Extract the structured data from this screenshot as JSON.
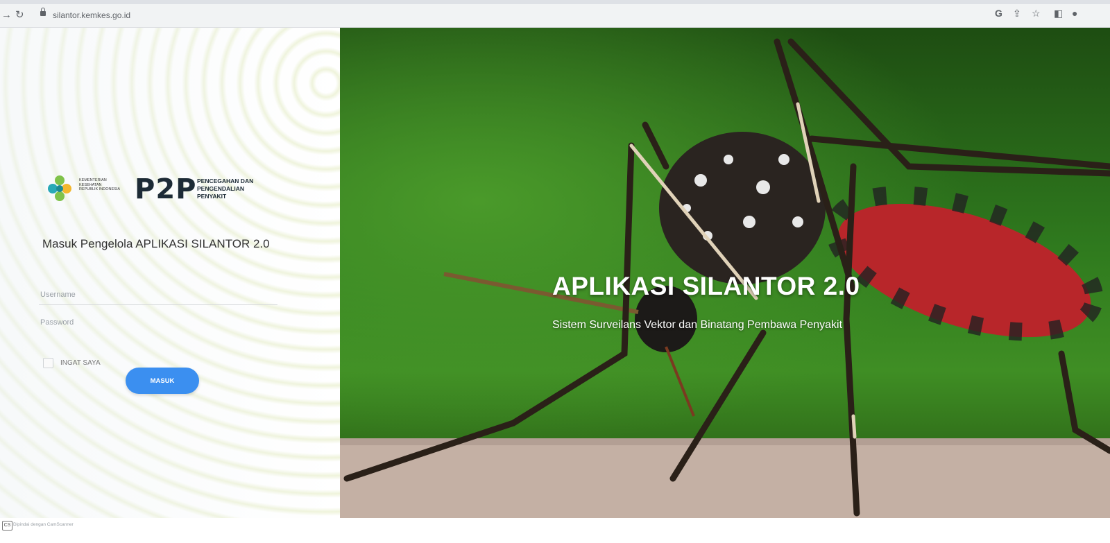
{
  "browser": {
    "url": "silantor.kemkes.go.id",
    "icons": [
      "google-icon",
      "share-icon",
      "star-icon",
      "sidebar-icon",
      "profile-icon"
    ]
  },
  "login": {
    "kemenkes_text": "KEMENTERIAN KESEHATAN REPUBLIK INDONESIA",
    "p2p_logo": "P2P",
    "p2p_desc_line1": "PENCEGAHAN DAN",
    "p2p_desc_line2": "PENGENDALIAN",
    "p2p_desc_line3": "PENYAKIT",
    "heading": "Masuk Pengelola APLIKASI SILANTOR 2.0",
    "username_placeholder": "Username",
    "password_placeholder": "Password",
    "remember_label": "INGAT SAYA",
    "submit_label": "MASUK"
  },
  "hero": {
    "title": "APLIKASI SILANTOR 2.0",
    "subtitle": "Sistem Surveilans Vektor dan Binatang Pembawa Penyakit"
  },
  "scanner": {
    "badge": "CS",
    "text": "Dipindai dengan CamScanner"
  },
  "colors": {
    "button": "#3b8ff0",
    "hero_green": "#2f7a1e",
    "mosquito_body": "#b8262a"
  }
}
